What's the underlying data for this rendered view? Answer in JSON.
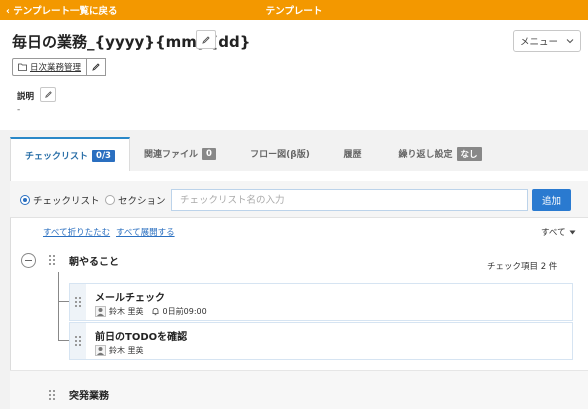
{
  "topbar": {
    "back_label": "テンプレート一覧に戻る",
    "title": "テンプレート",
    "color": "#f39800"
  },
  "header": {
    "page_title": "毎日の業務_{yyyy}{mm}{dd}",
    "menu_label": "メニュー",
    "folder_label": "日次業務管理",
    "description_label": "説明",
    "description_value": "-"
  },
  "tabs": [
    {
      "label": "チェックリスト",
      "badge": "0/3",
      "active": true
    },
    {
      "label": "関連ファイル",
      "badge": "0",
      "active": false
    },
    {
      "label": "フロー図(β版)",
      "badge": "",
      "active": false
    },
    {
      "label": "履歴",
      "badge": "",
      "active": false
    },
    {
      "label": "繰り返し設定",
      "badge": "なし",
      "active": false
    }
  ],
  "add_form": {
    "radio_checklist": "チェックリスト",
    "radio_section": "セクション",
    "selected": "checklist",
    "placeholder": "チェックリスト名の入力",
    "add_label": "追加"
  },
  "controls": {
    "collapse_all": "すべて折りたたむ",
    "expand_all": "すべて展開する",
    "filter": "すべて"
  },
  "sections": [
    {
      "title": "朝やること",
      "count_label": "チェック項目 2 件",
      "items": [
        {
          "name": "メールチェック",
          "assignee": "鈴木 里英",
          "deadline": "0日前09:00"
        },
        {
          "name": "前日のTODOを確認",
          "assignee": "鈴木 里英",
          "deadline": ""
        }
      ]
    },
    {
      "title": "突発業務",
      "items": []
    }
  ],
  "colors": {
    "accent_blue": "#2a7ad0",
    "link_blue": "#2a6fc0"
  }
}
